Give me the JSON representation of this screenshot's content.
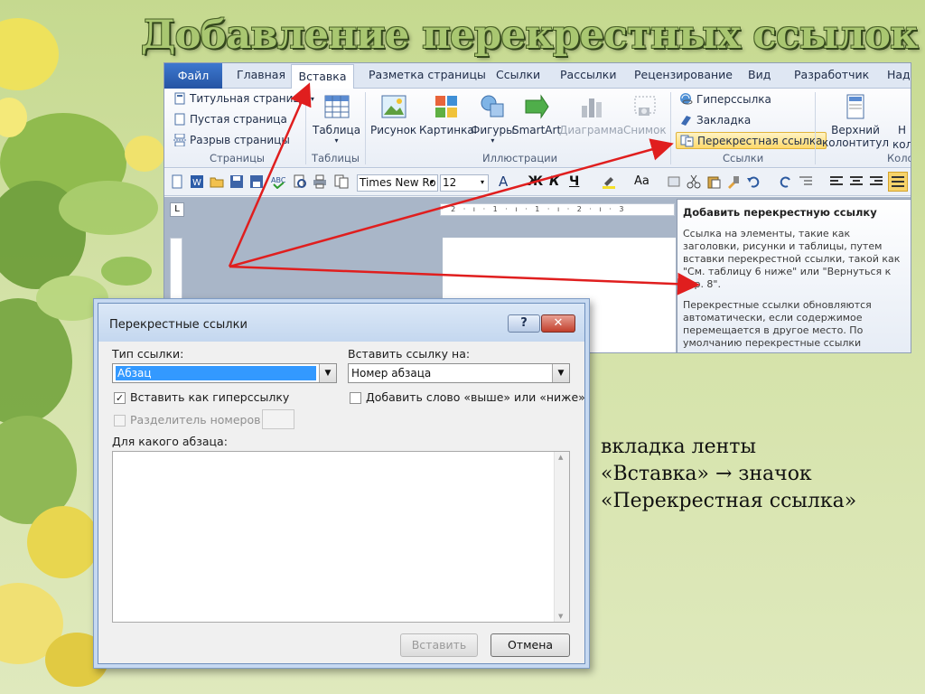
{
  "slide": {
    "title": "Добавление перекрестных ссылок",
    "caption_lines": [
      "вкладка ленты",
      "«Вставка» → значок",
      "«Перекрестная ссылка»"
    ]
  },
  "ribbon": {
    "tabs": [
      "Файл",
      "Главная",
      "Вставка",
      "Разметка страницы",
      "Ссылки",
      "Рассылки",
      "Рецензирование",
      "Вид",
      "Разработчик",
      "Над"
    ],
    "active_tab": "Вставка",
    "groups": {
      "pages": {
        "label": "Страницы",
        "items": [
          "Титульная страница",
          "Пустая страница",
          "Разрыв страницы"
        ]
      },
      "tables": {
        "label": "Таблицы",
        "button": "Таблица"
      },
      "illustrations": {
        "label": "Иллюстрации",
        "buttons": [
          "Рисунок",
          "Картинка",
          "Фигуры",
          "SmartArt",
          "Диаграмма",
          "Снимок"
        ]
      },
      "links": {
        "label": "Ссылки",
        "items": [
          "Гиперссылка",
          "Закладка",
          "Перекрестная ссылка"
        ]
      },
      "header": {
        "label": "Коло",
        "button_line1": "Верхний",
        "button_line2": "колонтитул",
        "cut_button": "Н",
        "cut_button2": "коло"
      }
    }
  },
  "toolbar": {
    "font_name": "Times New Ro",
    "font_size": "12",
    "text_glyphs": [
      "A",
      "Ж",
      "К",
      "Ч",
      "Aa"
    ]
  },
  "ruler_text": "· 2 · ı · 1 · ı · 1 · ı · 2 · ı · 3",
  "tooltip": {
    "title": "Добавить перекрестную ссылку",
    "p1": "Ссылка на элементы, такие как заголовки, рисунки и таблицы, путем вставки перекрестной ссылки, такой как \"См. таблицу 6 ниже\" или \"Вернуться к стр. 8\".",
    "p2": "Перекрестные ссылки обновляются автоматически, если содержимое перемещается в другое место. По умолчанию перекрестные ссылки вставляются как гиперссылки."
  },
  "dialog": {
    "title": "Перекрестные ссылки",
    "help_label": "?",
    "close_label": "✕",
    "link_type_label": "Тип ссылки:",
    "link_type_value": "Абзац",
    "insert_ref_label": "Вставить ссылку на:",
    "insert_ref_value": "Номер абзаца",
    "insert_as_hyperlink": {
      "label": "Вставить как гиперссылку",
      "checked": true
    },
    "above_below": {
      "label": "Добавить слово «выше» или «ниже»",
      "checked": false
    },
    "number_separator": {
      "label": "Разделитель номеров",
      "checked": false,
      "enabled": false
    },
    "for_which_label": "Для какого абзаца:",
    "insert_button": "Вставить",
    "cancel_button": "Отмена"
  },
  "colors": {
    "arrow": "#e01e1e",
    "slide_bg": "#c9dc94",
    "title_fill": "#a9c771"
  }
}
